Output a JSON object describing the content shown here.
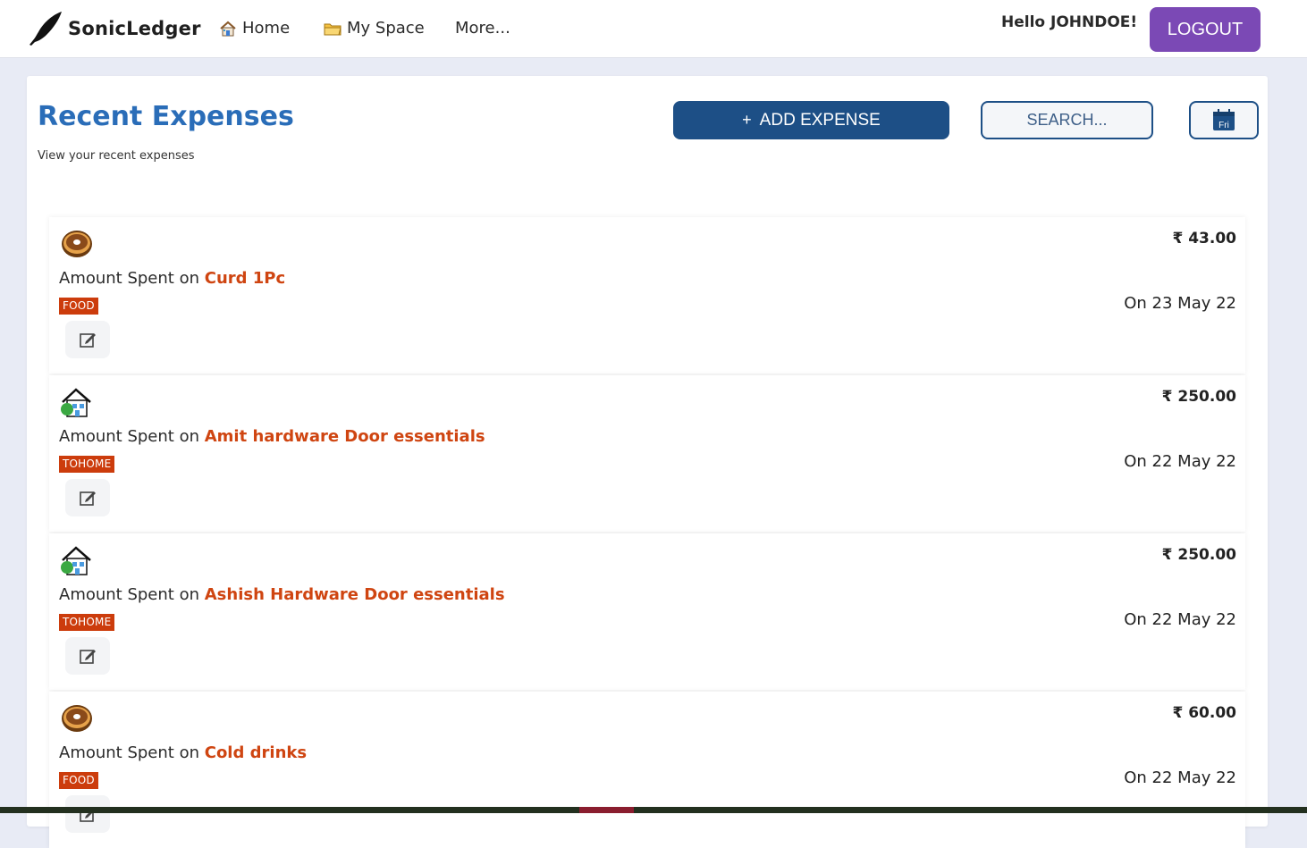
{
  "app": {
    "name": "SonicLedger"
  },
  "nav": {
    "items": [
      {
        "label": "Home",
        "icon": "home-icon"
      },
      {
        "label": "My Space",
        "icon": "folder-icon"
      },
      {
        "label": "More...",
        "icon": ""
      }
    ],
    "greeting": "Hello JOHNDOE!",
    "logout_label": "LOGOUT"
  },
  "page": {
    "title": "Recent Expenses",
    "subtitle": "View your recent expenses",
    "add_label": "ADD EXPENSE",
    "add_icon": "plus-icon",
    "search_label": "SEARCH...",
    "calendar_day": "Fri",
    "calendar_icon": "calendar-icon"
  },
  "expense_prefix": "Amount Spent on",
  "expenses": [
    {
      "icon": "donut-icon",
      "title": "Curd 1Pc",
      "category": "FOOD",
      "amount": "₹ 43.00",
      "date": "On 23 May 22"
    },
    {
      "icon": "house-icon",
      "title": "Amit hardware Door essentials",
      "category": "TOHOME",
      "amount": "₹ 250.00",
      "date": "On 22 May 22"
    },
    {
      "icon": "house-icon",
      "title": "Ashish Hardware Door essentials",
      "category": "TOHOME",
      "amount": "₹ 250.00",
      "date": "On 22 May 22"
    },
    {
      "icon": "donut-icon",
      "title": "Cold drinks",
      "category": "FOOD",
      "amount": "₹ 60.00",
      "date": "On 22 May 22"
    }
  ],
  "colors": {
    "brand_purple": "#7b49b5",
    "primary_blue": "#1d4f86",
    "title_blue": "#2a6db8",
    "accent_orange": "#cf4511",
    "badge_red": "#cc3c0c",
    "page_bg": "#e8ebf5"
  }
}
